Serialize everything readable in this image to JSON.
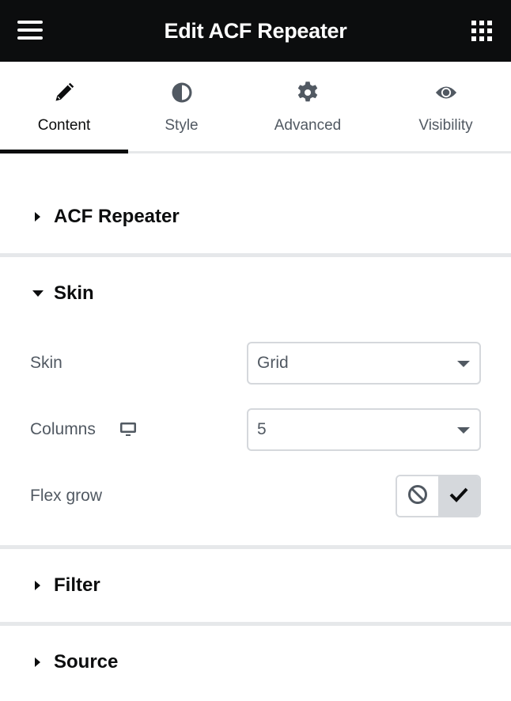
{
  "header": {
    "title": "Edit ACF Repeater",
    "menu_icon": "hamburger-icon",
    "apps_icon": "grid-apps-icon"
  },
  "tabs": [
    {
      "label": "Content",
      "icon": "pencil-icon",
      "active": true
    },
    {
      "label": "Style",
      "icon": "half-circle-icon",
      "active": false
    },
    {
      "label": "Advanced",
      "icon": "gear-icon",
      "active": false
    },
    {
      "label": "Visibility",
      "icon": "eye-icon",
      "active": false
    }
  ],
  "sections": [
    {
      "label": "ACF Repeater",
      "expanded": false
    },
    {
      "label": "Skin",
      "expanded": true
    },
    {
      "label": "Filter",
      "expanded": false
    },
    {
      "label": "Source",
      "expanded": false
    }
  ],
  "skin_controls": {
    "skin": {
      "label": "Skin",
      "value": "Grid"
    },
    "columns": {
      "label": "Columns",
      "value": "5",
      "device_icon": "desktop-icon"
    },
    "flex_grow": {
      "label": "Flex grow",
      "selected": "yes",
      "options": [
        "no",
        "yes"
      ]
    }
  },
  "colors": {
    "topbar": "#0c0d0e",
    "text_primary": "#0c0d0e",
    "text_secondary": "#515962",
    "border": "#d5d8dc",
    "divider": "#e6e8ea"
  }
}
